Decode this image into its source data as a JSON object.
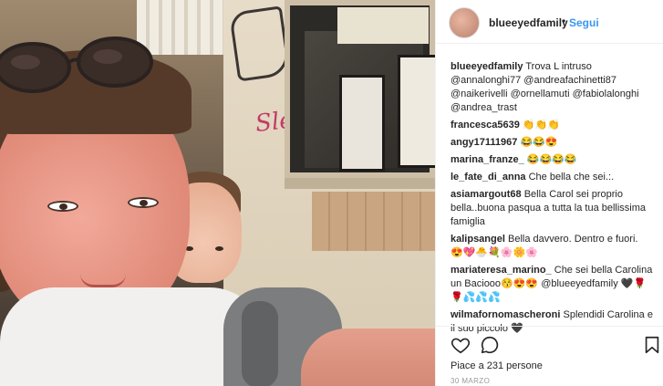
{
  "post": {
    "username": "blueeyedfamily",
    "separator": "•",
    "follow_label": "Segui",
    "likes_text": "Piace a 231 persone",
    "date": "30 MARZO",
    "graffiti_text": "Slen"
  },
  "colors": {
    "link_blue": "#3897f0",
    "text": "#262626",
    "muted": "#999999"
  },
  "icons": [
    "heart-icon",
    "comment-icon",
    "bookmark-icon"
  ],
  "comments": [
    {
      "user": "blueeyedfamily",
      "text": "Trova L intruso @annalonghi77 @andreafachinetti87 @naikerivelli @ornellamuti @fabiolalonghi @andrea_trast"
    },
    {
      "user": "francesca5639",
      "text": "👏👏👏"
    },
    {
      "user": "angy17111967",
      "text": "😂😂😍"
    },
    {
      "user": "marina_franze_",
      "text": "😂😂😂😂"
    },
    {
      "user": "le_fate_di_anna",
      "text": "Che bella che sei.:."
    },
    {
      "user": "asiamargout68",
      "text": "Bella Carol sei proprio bella..buona pasqua a tutta la tua bellissima famiglia"
    },
    {
      "user": "kalipsangel",
      "text": "Bella davvero. Dentro e fuori. 😍💖🐣💐🌸🌼🌸"
    },
    {
      "user": "mariateresa_marino_",
      "text": "Che sei bella Carolina un Baciooo😚😍😍 @blueeyedfamily 🖤🌹🌹💦💦💦"
    },
    {
      "user": "wilmafornomascheroni",
      "text": "Splendidi Carolina e il suo piccolo 🖤"
    }
  ]
}
